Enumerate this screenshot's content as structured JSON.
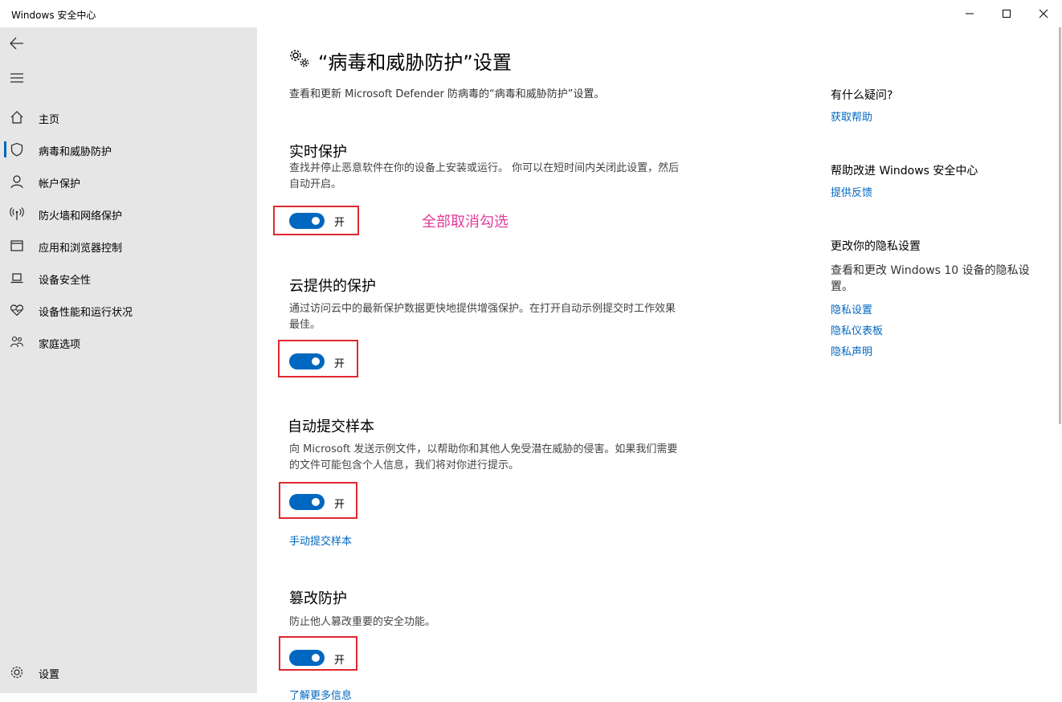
{
  "window": {
    "title": "Windows 安全中心"
  },
  "sidebar": {
    "items": [
      {
        "label": "主页",
        "icon": "home-icon"
      },
      {
        "label": "病毒和威胁防护",
        "icon": "shield-icon"
      },
      {
        "label": "帐户保护",
        "icon": "person-icon"
      },
      {
        "label": "防火墙和网络保护",
        "icon": "wireless-icon"
      },
      {
        "label": "应用和浏览器控制",
        "icon": "app-window-icon"
      },
      {
        "label": "设备安全性",
        "icon": "laptop-icon"
      },
      {
        "label": "设备性能和运行状况",
        "icon": "heart-icon"
      },
      {
        "label": "家庭选项",
        "icon": "family-icon"
      }
    ],
    "settings_label": "设置"
  },
  "main": {
    "title": "“病毒和威胁防护”设置",
    "subtitle": "查看和更新 Microsoft Defender 防病毒的“病毒和威胁防护”设置。",
    "annotation": "全部取消勾选",
    "sections": [
      {
        "title": "实时保护",
        "desc": "查找并停止恶意软件在你的设备上安装或运行。 你可以在短时间内关闭此设置，然后自动开启。",
        "toggle_label": "开",
        "toggle_on": true
      },
      {
        "title": "云提供的保护",
        "desc": "通过访问云中的最新保护数据更快地提供增强保护。在打开自动示例提交时工作效果最佳。",
        "toggle_label": "开",
        "toggle_on": true
      },
      {
        "title": "自动提交样本",
        "desc": "向 Microsoft 发送示例文件，以帮助你和其他人免受潜在威胁的侵害。如果我们需要的文件可能包含个人信息，我们将对你进行提示。",
        "toggle_label": "开",
        "toggle_on": true,
        "link": "手动提交样本"
      },
      {
        "title": "篡改防护",
        "desc": "防止他人篡改重要的安全功能。",
        "toggle_label": "开",
        "toggle_on": true,
        "link": "了解更多信息"
      }
    ]
  },
  "right_panel": {
    "help_heading": "有什么疑问?",
    "help_link": "获取帮助",
    "improve_heading": "帮助改进 Windows 安全中心",
    "feedback_link": "提供反馈",
    "privacy_heading": "更改你的隐私设置",
    "privacy_text": "查看和更改 Windows 10 设备的隐私设置。",
    "privacy_links": [
      "隐私设置",
      "隐私仪表板",
      "隐私声明"
    ]
  },
  "colors": {
    "accent": "#0067c0",
    "annotation": "#e23a9a",
    "highlight_box": "#e0282e",
    "sidebar_bg": "#e6e6e6"
  }
}
